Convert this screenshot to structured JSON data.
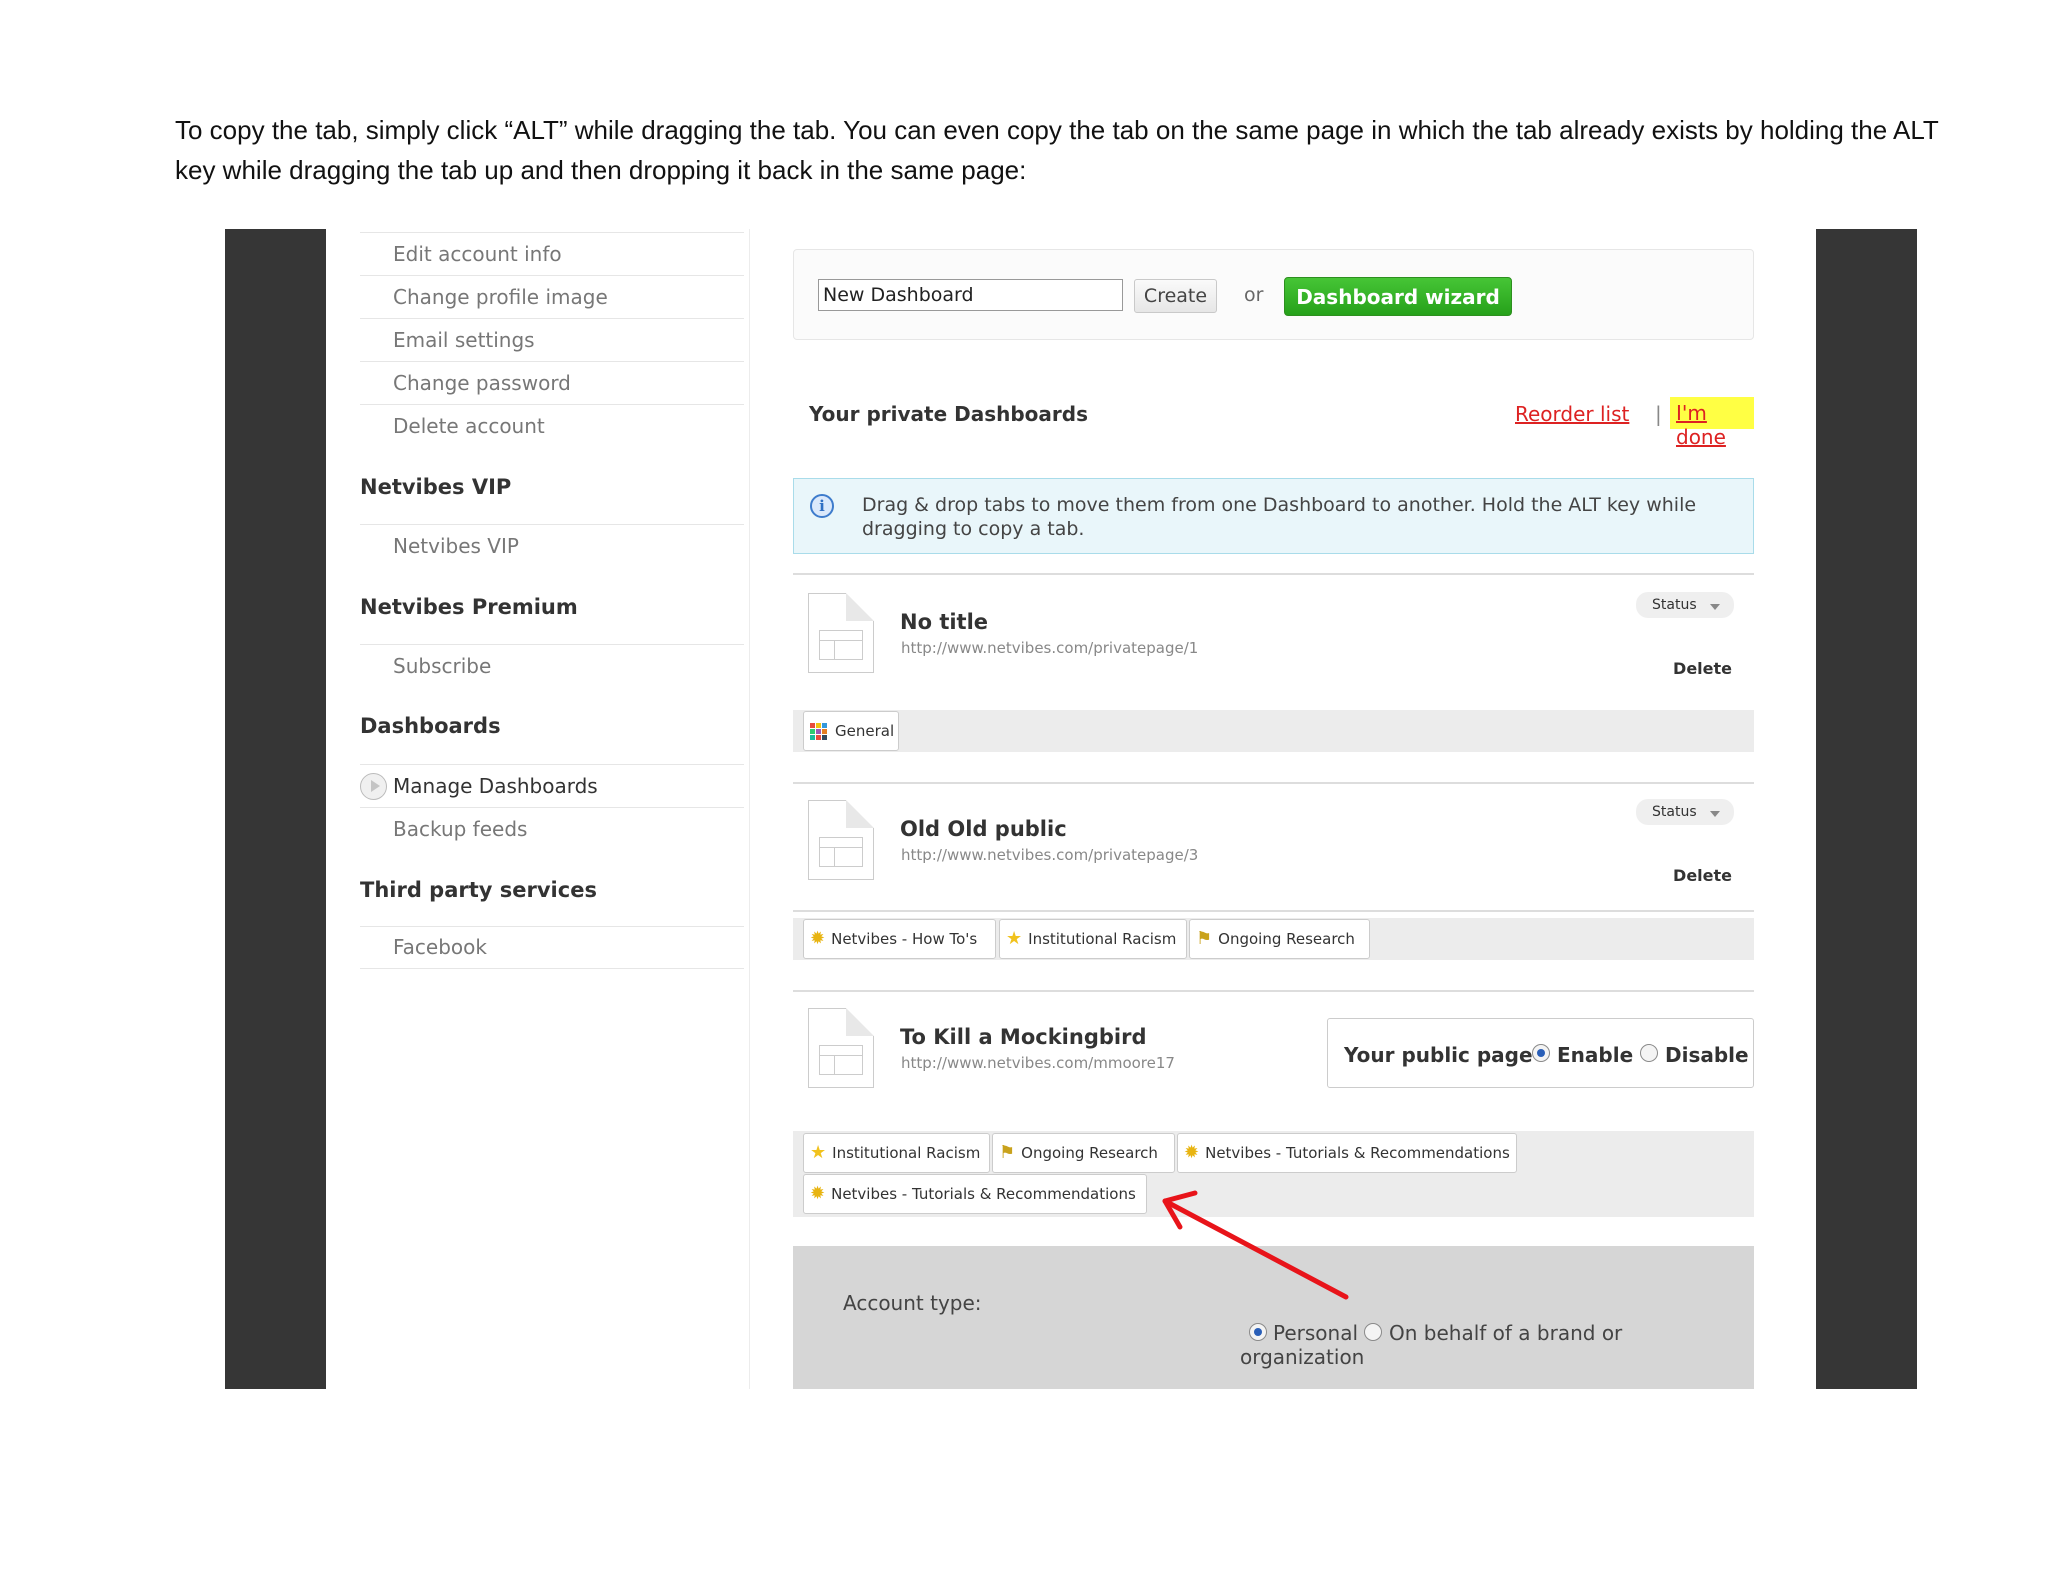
{
  "document": {
    "paragraph": "To copy the tab, simply click “ALT” while dragging the tab. You can even copy the tab on the same page in which the tab already exists by holding the ALT key while dragging the tab up and then dropping it back in the same page:"
  },
  "sidebar": {
    "account_items": [
      "Edit account info",
      "Change profile image",
      "Email settings",
      "Change password",
      "Delete account"
    ],
    "vip": {
      "heading": "Netvibes VIP",
      "items": [
        "Netvibes VIP"
      ]
    },
    "premium": {
      "heading": "Netvibes Premium",
      "items": [
        "Subscribe"
      ]
    },
    "dashboards": {
      "heading": "Dashboards",
      "items": [
        "Manage Dashboards",
        "Backup feeds"
      ]
    },
    "third_party": {
      "heading": "Third party services",
      "items": [
        "Facebook"
      ]
    }
  },
  "create": {
    "input_value": "New Dashboard",
    "create_label": "Create",
    "or_label": "or",
    "wizard_label": "Dashboard wizard"
  },
  "private": {
    "title": "Your private Dashboards",
    "reorder_label": "Reorder list",
    "separator": "|",
    "done_label": "I'm done"
  },
  "info": {
    "icon": "info-icon",
    "text": "Drag & drop tabs to move them from one Dashboard to another. Hold the ALT key while dragging to copy a tab."
  },
  "dashboards": [
    {
      "title": "No title",
      "url": "http://www.netvibes.com/privatepage/1",
      "status_label": "Status",
      "delete_label": "Delete",
      "tabs": [
        {
          "label": "General",
          "icon": "grid-icon"
        }
      ]
    },
    {
      "title": "Old Old public",
      "url": "http://www.netvibes.com/privatepage/3",
      "status_label": "Status",
      "delete_label": "Delete",
      "tabs": [
        {
          "label": "Netvibes - How To's",
          "icon": "sun-icon"
        },
        {
          "label": "Institutional Racism",
          "icon": "star-icon"
        },
        {
          "label": "Ongoing Research",
          "icon": "flag-icon"
        }
      ]
    },
    {
      "title": "To Kill a Mockingbird",
      "url": "http://www.netvibes.com/mmoore17",
      "public_label": "Your public page",
      "enable_label": "Enable",
      "disable_label": "Disable",
      "public_enabled": true,
      "tabs": [
        {
          "label": "Institutional Racism",
          "icon": "star-icon"
        },
        {
          "label": "Ongoing Research",
          "icon": "flag-icon"
        },
        {
          "label": "Netvibes - Tutorials & Recommendations",
          "icon": "sun-icon"
        },
        {
          "label": "Netvibes - Tutorials & Recommendations",
          "icon": "sun-icon"
        }
      ]
    }
  ],
  "account": {
    "label": "Account type:",
    "personal_label": "Personal",
    "brand_label": "On behalf of a brand or",
    "brand_label_2": "organization",
    "selected": "Personal"
  },
  "colors": {
    "wizard_green": "#26a11a",
    "link_red": "#dd2222",
    "highlight_yellow": "#ffff44",
    "annotation_arrow": "#e8141a",
    "side_bars": "#363636"
  }
}
